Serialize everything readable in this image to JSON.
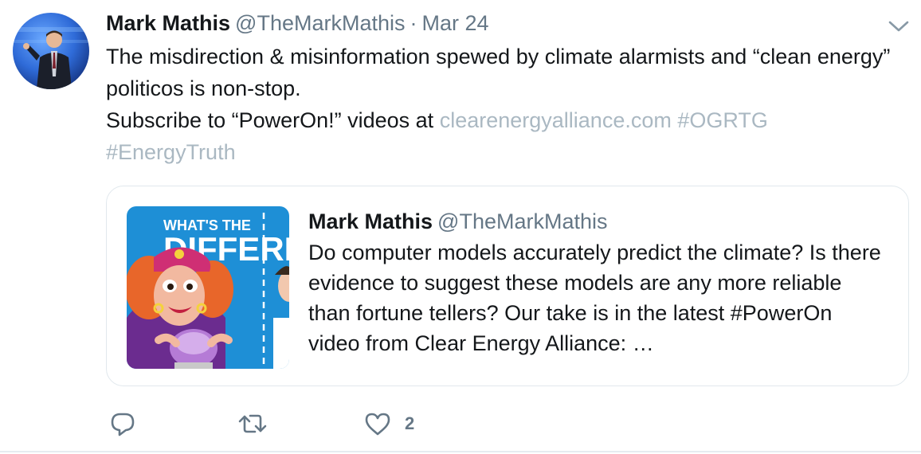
{
  "tweet": {
    "author_name": "Mark Mathis",
    "author_handle": "@TheMarkMathis",
    "separator": "·",
    "date": "Mar 24",
    "text_line1": "The misdirection & misinformation spewed by climate alarmists and “clean energy” politicos is non-stop.",
    "text_line2_prefix": "Subscribe to “PowerOn!” videos at",
    "link": "clearenergyalliance.com",
    "hashtag1": "#OGRTG",
    "hashtag2": "#EnergyTruth"
  },
  "quoted_tweet": {
    "author_name": "Mark Mathis",
    "author_handle": "@TheMarkMathis",
    "text": "Do computer models accurately predict the climate? Is there evidence to suggest these models are any more reliable than fortune tellers? Our take is in the latest #PowerOn video from Clear Energy Alliance: …",
    "thumbnail": {
      "line1": "WHAT'S THE",
      "line2": "DIFFERE"
    }
  },
  "actions": {
    "reply_icon": "reply-icon",
    "retweet_icon": "retweet-icon",
    "like_icon": "heart-icon",
    "like_count": "2"
  },
  "colors": {
    "text": "#14171a",
    "secondary": "#657786",
    "link_faded": "#aab8c2",
    "border": "#e1e8ed",
    "thumb_bg": "#1e8fd6"
  }
}
